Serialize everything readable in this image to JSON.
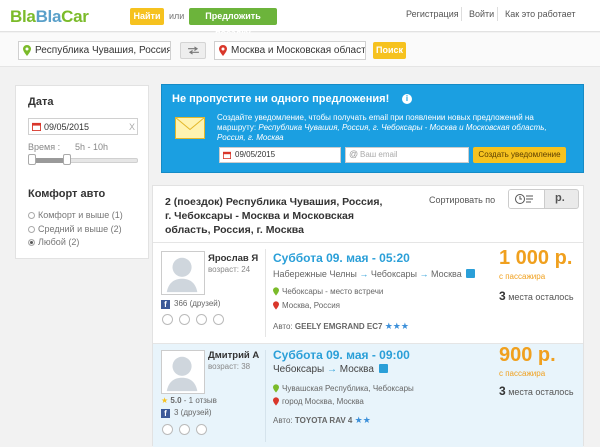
{
  "header": {
    "logo": {
      "part1": "Bla",
      "part2": "Bla",
      "part3": "Car"
    },
    "find_button": "Найти",
    "or_text": "или",
    "offer_button": "Предложить поездку",
    "links": {
      "register": "Регистрация",
      "login": "Войти",
      "how_it_works": "Как это работает"
    }
  },
  "search": {
    "from_value": "Республика Чувашия, Россия, г. Чебоксары",
    "to_value": "Москва и Московская область, Россия",
    "search_button": "Поиск"
  },
  "sidebar": {
    "date_heading": "Дата",
    "date_value": "09/05/2015",
    "date_clear": "X",
    "time_label": "Время :",
    "time_range": "5h - 10h",
    "comfort_heading": "Комфорт авто",
    "comfort_options": [
      {
        "label": "Комфорт и выше",
        "count": "(1)"
      },
      {
        "label": "Средний и выше",
        "count": "(2)"
      },
      {
        "label": "Любой",
        "count": "(2)"
      }
    ],
    "selected_comfort_index": 2
  },
  "alert": {
    "title": "Не пропустите ни одного предложения!",
    "info_icon": "i",
    "text_line1": "Создайте уведомление, чтобы получать email при появлении новых предложений на",
    "text_line2_prefix": "маршруту: ",
    "text_line2_route": "Республика Чувашия, Россия, г. Чебоксары - Москва и Московская область,",
    "text_line3": "Россия, г. Москва",
    "date_value": "09/05/2015",
    "email_placeholder": "Ваш email",
    "create_button": "Создать уведомление"
  },
  "results": {
    "heading_line1": "2 (поездок) Республика Чувашия, Россия,",
    "heading_line2": "г. Чебоксары - Москва и Московская",
    "heading_line3": "область, Россия, г. Москва",
    "sort_label": "Сортировать по",
    "sort_price": "р.",
    "trips": [
      {
        "driver_name": "Ярослав Я",
        "age": "возраст: 24",
        "rating": "",
        "friends": "366 (друзей)",
        "date": "Суббота 09. мая - 05:20",
        "route_from": "Набережные Челны",
        "route_mid": "Чебоксары",
        "route_to": "Москва",
        "meeting": "Чебоксары - место встречи",
        "destination": "Москва, Россия",
        "car_label": "Авто:",
        "car": "GEELY EMGRAND EC7",
        "price": "1 000 р.",
        "price_note": "с пассажира",
        "seats_num": "3",
        "seats_text": "места осталось"
      },
      {
        "driver_name": "Дмитрий А",
        "age": "возраст: 38",
        "rating": "5.0",
        "rating_count": "- 1 отзыв",
        "friends": "3 (друзей)",
        "date": "Суббота 09. мая - 09:00",
        "route_from": "Чебоксары",
        "route_mid": "",
        "route_to": "Москва",
        "meeting": "Чувашская Республика, Чебоксары",
        "destination": "город Москва, Москва",
        "car_label": "Авто:",
        "car": "TOYOTA RAV 4",
        "price": "900 р.",
        "price_note": "с пассажира",
        "seats_num": "3",
        "seats_text": "места осталось"
      }
    ]
  },
  "colors": {
    "brand_green": "#7bbb2a",
    "brand_blue": "#5aa0c9",
    "orange_price": "#f0a01e",
    "link_blue": "#2a9fd8"
  },
  "icons": [
    "pin-green-icon",
    "pin-red-icon",
    "swap-icon",
    "calendar-icon",
    "envelope-icon",
    "email-at-icon",
    "clock-icon",
    "facebook-icon",
    "star-icon",
    "highway-icon"
  ]
}
